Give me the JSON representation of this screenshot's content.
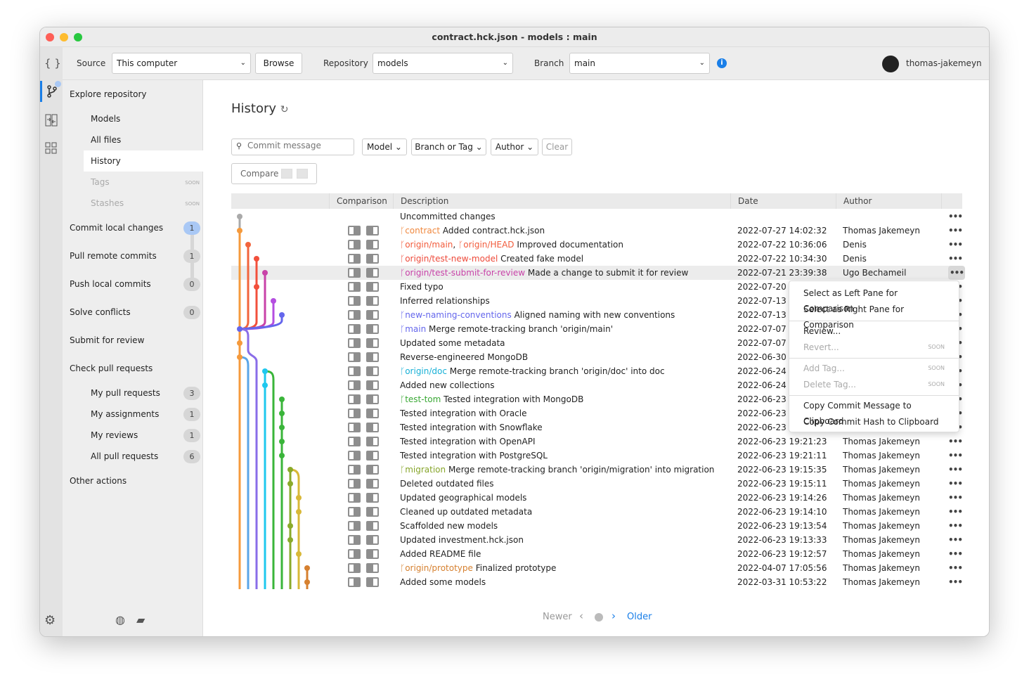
{
  "window": {
    "title": "contract.hck.json - models : main"
  },
  "toolbar": {
    "source_label": "Source",
    "source_value": "This computer",
    "browse": "Browse",
    "repo_label": "Repository",
    "repo_value": "models",
    "branch_label": "Branch",
    "branch_value": "main",
    "user": "thomas-jakemeyn"
  },
  "sidebar": {
    "explore": "Explore repository",
    "models": "Models",
    "all_files": "All files",
    "history": "History",
    "tags": "Tags",
    "stashes": "Stashes",
    "soon": "SOON",
    "actions": [
      {
        "label": "Commit local changes",
        "count": "1"
      },
      {
        "label": "Pull remote commits",
        "count": "1"
      },
      {
        "label": "Push local commits",
        "count": "0"
      },
      {
        "label": "Solve conflicts",
        "count": "0"
      },
      {
        "label": "Submit for review"
      },
      {
        "label": "Check pull requests"
      }
    ],
    "prs": [
      {
        "label": "My pull requests",
        "count": "3"
      },
      {
        "label": "My assignments",
        "count": "1"
      },
      {
        "label": "My reviews",
        "count": "1"
      },
      {
        "label": "All pull requests",
        "count": "6"
      }
    ],
    "other": "Other actions"
  },
  "main": {
    "title": "History",
    "filters": {
      "search_placeholder": "Commit message",
      "model": "Model",
      "branch_or_tag": "Branch or Tag",
      "author": "Author",
      "clear": "Clear",
      "compare": "Compare"
    },
    "columns": {
      "comparison": "Comparison",
      "description": "Description",
      "date": "Date",
      "author": "Author"
    },
    "rows": [
      {
        "desc": "Uncommitted changes",
        "date": "",
        "author": ""
      },
      {
        "tags": [
          {
            "name": "contract",
            "color": "#f0883e"
          }
        ],
        "desc": "Added contract.hck.json",
        "date": "2022-07-27 14:02:32",
        "author": "Thomas Jakemeyn"
      },
      {
        "tags": [
          {
            "name": "origin/main",
            "color": "#f25c3c"
          },
          {
            "name": "origin/HEAD",
            "color": "#f25c3c"
          }
        ],
        "desc": "Improved documentation",
        "date": "2022-07-22 10:36:06",
        "author": "Denis"
      },
      {
        "tags": [
          {
            "name": "origin/test-new-model",
            "color": "#ee4a3a"
          }
        ],
        "desc": "Created fake model",
        "date": "2022-07-22 10:34:30",
        "author": "Denis"
      },
      {
        "tags": [
          {
            "name": "origin/test-submit-for-review",
            "color": "#c842a8"
          }
        ],
        "desc": "Made a change to submit it for review",
        "date": "2022-07-21 23:39:38",
        "author": "Ugo Bechameil",
        "highlight": true
      },
      {
        "desc": "Fixed typo",
        "date": "2022-07-20 1",
        "author": ""
      },
      {
        "desc": "Inferred relationships",
        "date": "2022-07-13 1",
        "author": ""
      },
      {
        "tags": [
          {
            "name": "new-naming-conventions",
            "color": "#6466ec"
          }
        ],
        "desc": "Aligned naming with new conventions",
        "date": "2022-07-13 1",
        "author": ""
      },
      {
        "tags": [
          {
            "name": "main",
            "color": "#6466ec"
          }
        ],
        "desc": "Merge remote-tracking branch 'origin/main'",
        "date": "2022-07-07 1",
        "author": ""
      },
      {
        "desc": "Updated some metadata",
        "date": "2022-07-07 1",
        "author": ""
      },
      {
        "desc": "Reverse-engineered MongoDB",
        "date": "2022-06-30 1",
        "author": ""
      },
      {
        "tags": [
          {
            "name": "origin/doc",
            "color": "#17b0d6"
          }
        ],
        "desc": "Merge remote-tracking branch 'origin/doc' into doc",
        "date": "2022-06-24 0",
        "author": ""
      },
      {
        "desc": "Added new collections",
        "date": "2022-06-24 0",
        "author": ""
      },
      {
        "tags": [
          {
            "name": "test-tom",
            "color": "#39a834"
          }
        ],
        "desc": "Tested integration with MongoDB",
        "date": "2022-06-23 1",
        "author": ""
      },
      {
        "desc": "Tested integration with Oracle",
        "date": "2022-06-23 1",
        "author": ""
      },
      {
        "desc": "Tested integration with Snowflake",
        "date": "2022-06-23 1",
        "author": ""
      },
      {
        "desc": "Tested integration with OpenAPI",
        "date": "2022-06-23 19:21:23",
        "author": "Thomas Jakemeyn"
      },
      {
        "desc": "Tested integration with PostgreSQL",
        "date": "2022-06-23 19:21:11",
        "author": "Thomas Jakemeyn"
      },
      {
        "tags": [
          {
            "name": "migration",
            "color": "#86a52a"
          }
        ],
        "desc": "Merge remote-tracking branch 'origin/migration' into migration",
        "date": "2022-06-23 19:15:35",
        "author": "Thomas Jakemeyn"
      },
      {
        "desc": "Deleted outdated files",
        "date": "2022-06-23 19:15:11",
        "author": "Thomas Jakemeyn"
      },
      {
        "desc": "Updated geographical models",
        "date": "2022-06-23 19:14:26",
        "author": "Thomas Jakemeyn"
      },
      {
        "desc": "Cleaned up outdated metadata",
        "date": "2022-06-23 19:14:10",
        "author": "Thomas Jakemeyn"
      },
      {
        "desc": "Scaffolded new models",
        "date": "2022-06-23 19:13:54",
        "author": "Thomas Jakemeyn"
      },
      {
        "desc": "Updated investment.hck.json",
        "date": "2022-06-23 19:13:33",
        "author": "Thomas Jakemeyn"
      },
      {
        "desc": "Added README file",
        "date": "2022-06-23 19:12:57",
        "author": "Thomas Jakemeyn"
      },
      {
        "tags": [
          {
            "name": "origin/prototype",
            "color": "#d6802f"
          }
        ],
        "desc": "Finalized prototype",
        "date": "2022-04-07 17:05:56",
        "author": "Thomas Jakemeyn"
      },
      {
        "desc": "Added some models",
        "date": "2022-03-31 10:53:22",
        "author": "Thomas Jakemeyn"
      }
    ],
    "menu": [
      {
        "label": "Select as Left Pane for Comparison"
      },
      {
        "label": "Select as Right Pane for Comparison"
      },
      {
        "label": "Review..."
      },
      {
        "label": "Revert...",
        "soon": "SOON"
      },
      {
        "label": "Add Tag...",
        "soon": "SOON"
      },
      {
        "label": "Delete Tag...",
        "soon": "SOON"
      },
      {
        "label": "Copy Commit Message to Clipboard"
      },
      {
        "label": "Copy Commit Hash to Clipboard"
      }
    ],
    "pagination": {
      "newer": "Newer",
      "older": "Older"
    }
  },
  "colors": {
    "accent": "#1a7fe8",
    "active_badge": "#a9c8f5"
  }
}
